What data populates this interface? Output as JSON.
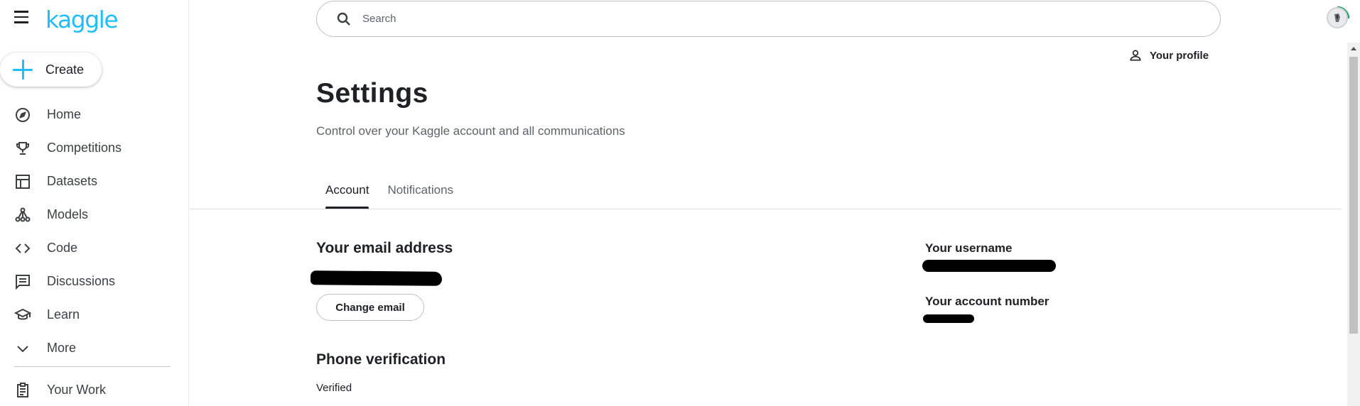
{
  "brand": {
    "logo_text": "kaggle",
    "accent_color": "#20beff"
  },
  "sidebar": {
    "create_label": "Create",
    "items": [
      {
        "label": "Home",
        "icon": "compass-icon"
      },
      {
        "label": "Competitions",
        "icon": "trophy-icon"
      },
      {
        "label": "Datasets",
        "icon": "table-icon"
      },
      {
        "label": "Models",
        "icon": "models-icon"
      },
      {
        "label": "Code",
        "icon": "code-icon"
      },
      {
        "label": "Discussions",
        "icon": "comment-icon"
      },
      {
        "label": "Learn",
        "icon": "school-icon"
      },
      {
        "label": "More",
        "icon": "chevron-down-icon"
      }
    ],
    "your_work_label": "Your Work"
  },
  "search": {
    "placeholder": "Search",
    "value": ""
  },
  "header": {
    "profile_link": "Your profile"
  },
  "page": {
    "title": "Settings",
    "subtitle": "Control over your Kaggle account and all communications",
    "tabs": [
      {
        "label": "Account",
        "active": true
      },
      {
        "label": "Notifications",
        "active": false
      }
    ]
  },
  "account": {
    "email_heading": "Your email address",
    "change_email_label": "Change email",
    "phone_heading": "Phone verification",
    "phone_status": "Verified",
    "username_label": "Your username",
    "account_number_label": "Your account number"
  }
}
